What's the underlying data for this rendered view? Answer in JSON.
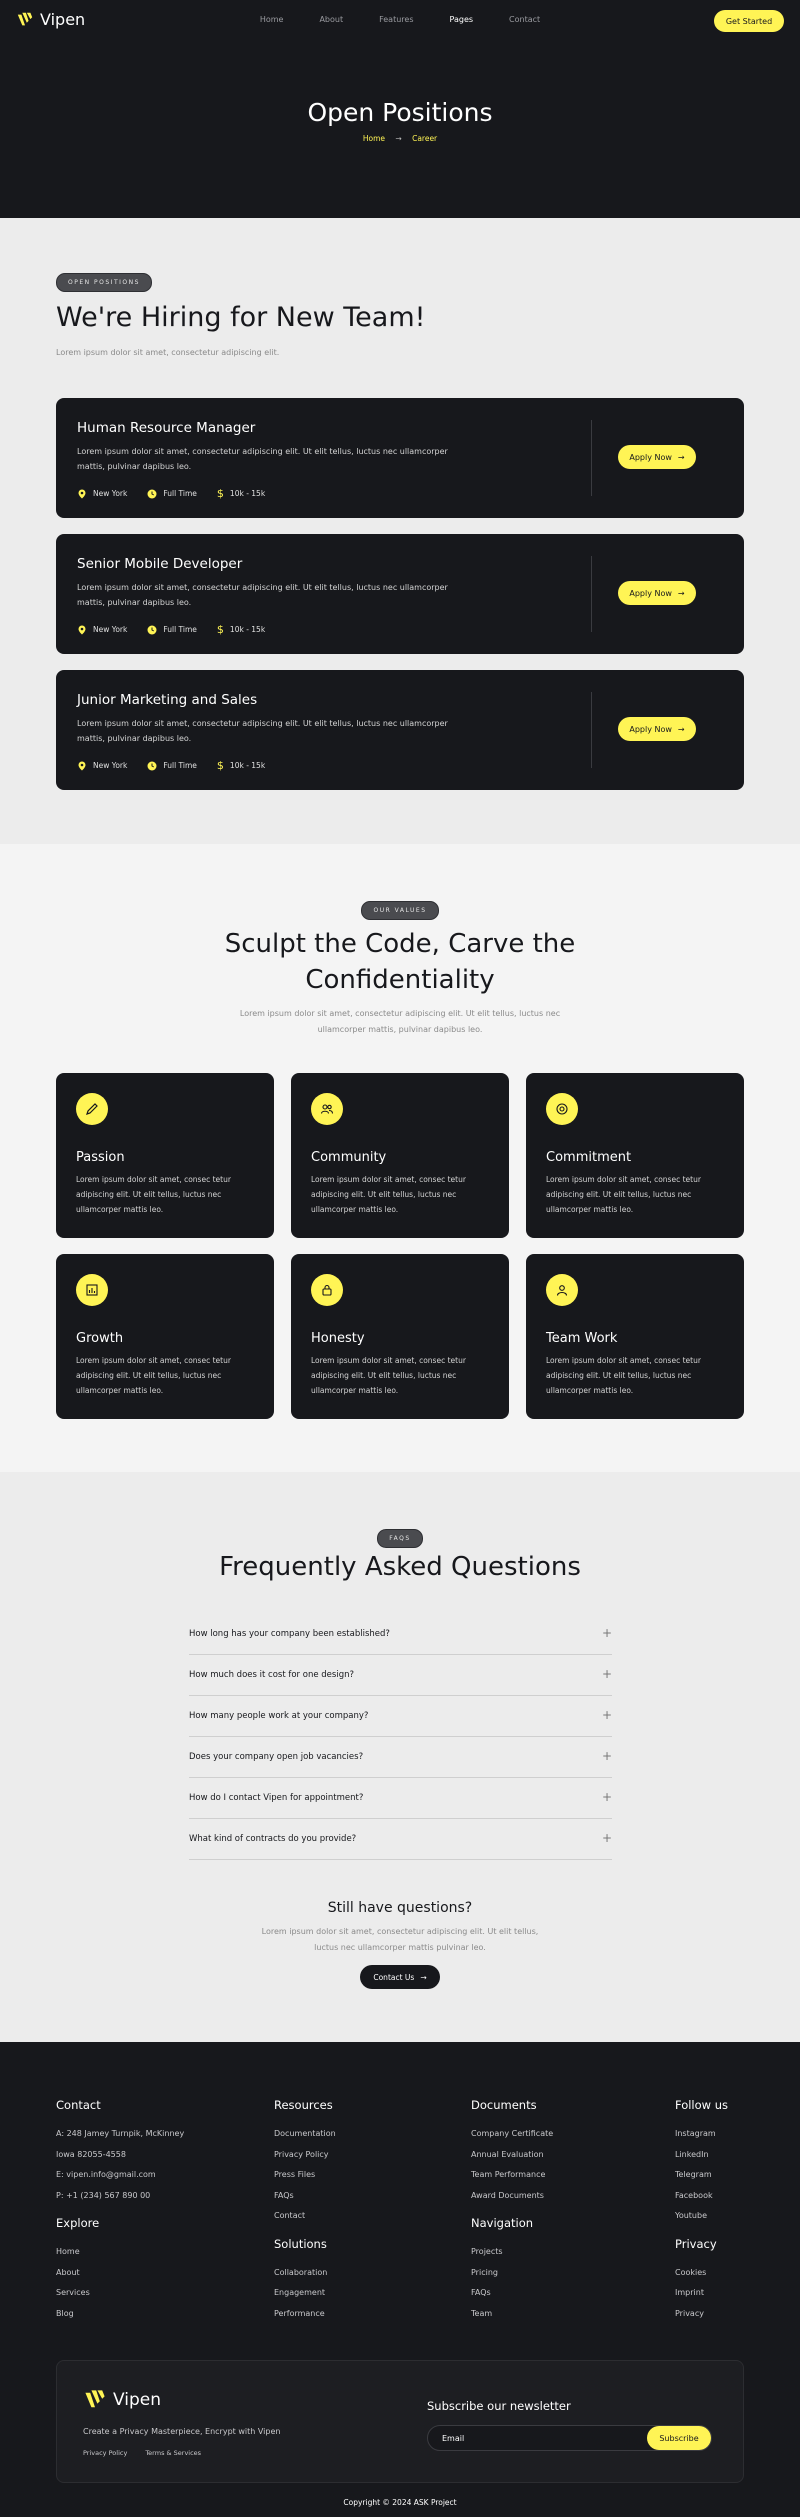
{
  "brand": {
    "name": "Vipen",
    "accent": "#fff455",
    "dark": "#17181c"
  },
  "nav": {
    "links": [
      "Home",
      "About",
      "Features",
      "Pages",
      "Contact"
    ],
    "active": "Pages",
    "cta": "Get Started"
  },
  "hero": {
    "title": "Open Positions",
    "crumb_home": "Home",
    "crumb_current": "Career"
  },
  "positions": {
    "badge": "OPEN POSITIONS",
    "title": "We're Hiring for New Team!",
    "subtitle": "Lorem ipsum dolor sit amet, consectetur adipiscing elit.",
    "jobs": [
      {
        "title": "Human Resource Manager",
        "desc": "Lorem ipsum dolor sit amet, consectetur adipiscing elit. Ut elit tellus, luctus nec ullamcorper mattis, pulvinar dapibus leo.",
        "location": "New York",
        "type": "Full Time",
        "salary": "10k - 15k",
        "apply": "Apply Now"
      },
      {
        "title": "Senior Mobile Developer",
        "desc": "Lorem ipsum dolor sit amet, consectetur adipiscing elit. Ut elit tellus, luctus nec ullamcorper mattis, pulvinar dapibus leo.",
        "location": "New York",
        "type": "Full Time",
        "salary": "10k - 15k",
        "apply": "Apply Now"
      },
      {
        "title": "Junior Marketing and Sales",
        "desc": "Lorem ipsum dolor sit amet, consectetur adipiscing elit. Ut elit tellus, luctus nec ullamcorper mattis, pulvinar dapibus leo.",
        "location": "New York",
        "type": "Full Time",
        "salary": "10k - 15k",
        "apply": "Apply Now"
      }
    ]
  },
  "values": {
    "badge": "OUR VALUES",
    "title_line1": "Sculpt the Code, Carve the",
    "title_line2": "Confidentiality",
    "subtitle": "Lorem ipsum dolor sit amet, consectetur adipiscing elit. Ut elit tellus, luctus nec ullamcorper mattis, pulvinar dapibus leo.",
    "cards": [
      {
        "title": "Passion",
        "icon": "pencil-icon",
        "desc": "Lorem ipsum dolor sit amet, consec tetur adipiscing elit. Ut elit tellus, luctus nec ullamcorper mattis leo."
      },
      {
        "title": "Community",
        "icon": "people-icon",
        "desc": "Lorem ipsum dolor sit amet, consec tetur adipiscing elit. Ut elit tellus, luctus nec ullamcorper mattis leo."
      },
      {
        "title": "Commitment",
        "icon": "badge-icon",
        "desc": "Lorem ipsum dolor sit amet, consec tetur adipiscing elit. Ut elit tellus, luctus nec ullamcorper mattis leo."
      },
      {
        "title": "Growth",
        "icon": "chart-icon",
        "desc": "Lorem ipsum dolor sit amet, consec tetur adipiscing elit. Ut elit tellus, luctus nec ullamcorper mattis leo."
      },
      {
        "title": "Honesty",
        "icon": "lock-icon",
        "desc": "Lorem ipsum dolor sit amet, consec tetur adipiscing elit. Ut elit tellus, luctus nec ullamcorper mattis leo."
      },
      {
        "title": "Team Work",
        "icon": "user-icon",
        "desc": "Lorem ipsum dolor sit amet, consec tetur adipiscing elit. Ut elit tellus, luctus nec ullamcorper mattis leo."
      }
    ]
  },
  "faq": {
    "badge": "FAQS",
    "title": "Frequently Asked Questions",
    "questions": [
      "How long has your company been established?",
      "How much does it cost for one design?",
      "How many people work at your company?",
      "Does your company open job vacancies?",
      "How do I contact Vipen for appointment?",
      "What kind of contracts do you provide?"
    ],
    "still_title": "Still have questions?",
    "still_sub": "Lorem ipsum dolor sit amet, consectetur adipiscing elit. Ut elit tellus, luctus nec ullamcorper mattis pulvinar leo.",
    "contact_btn": "Contact Us"
  },
  "footer": {
    "contact": {
      "title": "Contact",
      "address1": "A: 248 Jamey Turnpik, McKinney",
      "address2": "Iowa 82055-4558",
      "email": "E: vipen.info@gmail.com",
      "phone": "P: +1 (234) 567 890 00"
    },
    "explore": {
      "title": "Explore",
      "links": [
        "Home",
        "About",
        "Services",
        "Blog"
      ]
    },
    "resources": {
      "title": "Resources",
      "links": [
        "Documentation",
        "Privacy Policy",
        "Press Files",
        "FAQs",
        "Contact"
      ]
    },
    "solutions": {
      "title": "Solutions",
      "links": [
        "Collaboration",
        "Engagement",
        "Performance"
      ]
    },
    "documents": {
      "title": "Documents",
      "links": [
        "Company Certificate",
        "Annual Evaluation",
        "Team Performance",
        "Award Documents"
      ]
    },
    "navigation": {
      "title": "Navigation",
      "links": [
        "Projects",
        "Pricing",
        "FAQs",
        "Team"
      ]
    },
    "follow": {
      "title": "Follow us",
      "links": [
        "Instagram",
        "LinkedIn",
        "Telegram",
        "Facebook",
        "Youtube"
      ]
    },
    "privacy": {
      "title": "Privacy",
      "links": [
        "Cookies",
        "Imprint",
        "Privacy"
      ]
    },
    "newsletter": {
      "brand": "Vipen",
      "tagline": "Create a Privacy Masterpiece, Encrypt with Vipen",
      "link1": "Privacy Policy",
      "link2": "Terms & Services",
      "title": "Subscribe our newsletter",
      "placeholder": "Email",
      "button": "Subscribe"
    },
    "copyright": "Copyright © 2024 ASK Project"
  }
}
